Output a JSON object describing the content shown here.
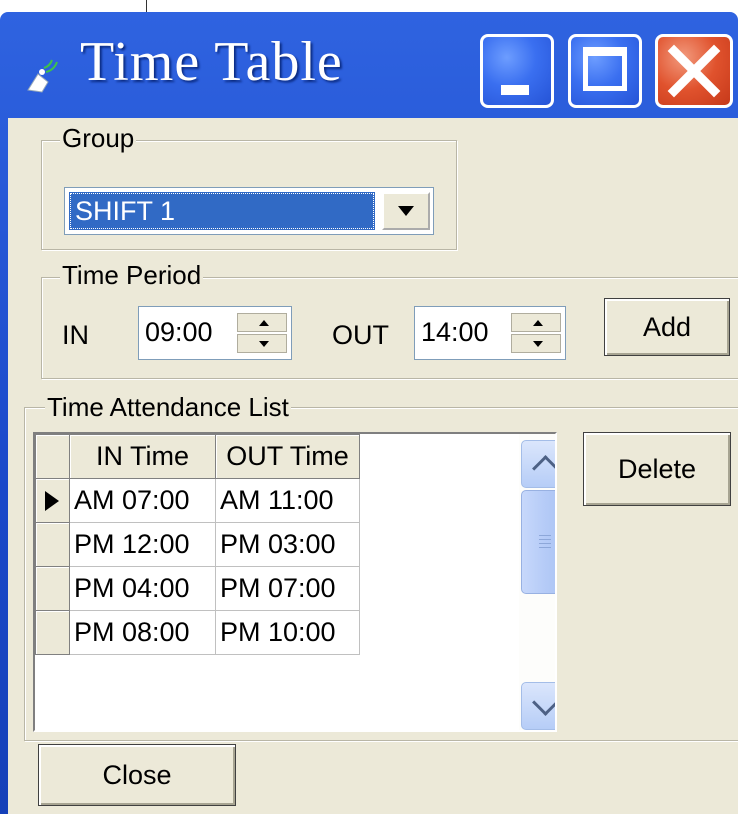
{
  "window": {
    "title": "Time Table",
    "app_icon": "app-icon"
  },
  "group": {
    "legend": "Group",
    "selected": "SHIFT 1"
  },
  "time_period": {
    "legend": "Time Period",
    "in_label": "IN",
    "in_value": "09:00",
    "out_label": "OUT",
    "out_value": "14:00",
    "add_label": "Add"
  },
  "attendance": {
    "legend": "Time Attendance List",
    "columns": [
      "IN Time",
      "OUT Time"
    ],
    "rows": [
      {
        "in": "AM 07:00",
        "out": "AM 11:00",
        "current": true
      },
      {
        "in": "PM 12:00",
        "out": "PM 03:00",
        "current": false
      },
      {
        "in": "PM 04:00",
        "out": "PM 07:00",
        "current": false
      },
      {
        "in": "PM 08:00",
        "out": "PM 10:00",
        "current": false
      }
    ],
    "delete_label": "Delete"
  },
  "footer": {
    "close_label": "Close"
  },
  "colors": {
    "titlebar": "#2457d6",
    "selection": "#316ac5",
    "dialog_face": "#ece9d8",
    "close_button": "#e0522d"
  }
}
